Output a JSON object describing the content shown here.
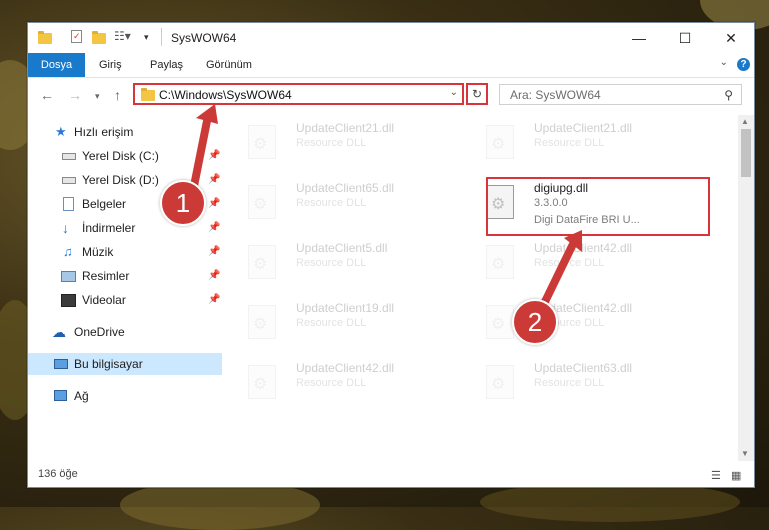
{
  "window": {
    "title": "SysWOW64"
  },
  "ribbon": {
    "tabs": [
      "Dosya",
      "Giriş",
      "Paylaş",
      "Görünüm"
    ]
  },
  "address": {
    "path": "C:\\Windows\\SysWOW64"
  },
  "search": {
    "placeholder": "Ara: SysWOW64"
  },
  "sidebar": {
    "quick_access": "Hızlı erişim",
    "items": [
      {
        "label": "Yerel Disk (C:)",
        "icon": "drive-icon"
      },
      {
        "label": "Yerel Disk (D:)",
        "icon": "drive-icon"
      },
      {
        "label": "Belgeler",
        "icon": "documents-icon"
      },
      {
        "label": "İndirmeler",
        "icon": "downloads-icon"
      },
      {
        "label": "Müzik",
        "icon": "music-icon"
      },
      {
        "label": "Resimler",
        "icon": "pictures-icon"
      },
      {
        "label": "Videolar",
        "icon": "videos-icon"
      }
    ],
    "onedrive": "OneDrive",
    "this_pc": "Bu bilgisayar",
    "network": "Ağ"
  },
  "files_left": [
    {
      "name": "UpdateClient21.dll",
      "desc": "Resource DLL"
    },
    {
      "name": "UpdateClient65.dll",
      "desc": "Resource DLL"
    },
    {
      "name": "UpdateClient5.dll",
      "desc": "Resource DLL"
    },
    {
      "name": "UpdateClient19.dll",
      "desc": "Resource DLL"
    },
    {
      "name": "UpdateClient42.dll",
      "desc": "Resource DLL"
    }
  ],
  "files_right": [
    {
      "name": "UpdateClient21.dll",
      "desc": "Resource DLL"
    },
    {
      "name": "digiupg.dll",
      "version": "3.3.0.0",
      "desc": "Digi DataFire BRI U..."
    },
    {
      "name": "UpdateClient42.dll",
      "desc": "Resource DLL"
    },
    {
      "name": "UpdateClient42.dll",
      "desc": "Resource DLL"
    },
    {
      "name": "UpdateClient63.dll",
      "desc": "Resource DLL"
    }
  ],
  "status": {
    "count": "136 öğe"
  },
  "callouts": {
    "one": "1",
    "two": "2"
  },
  "colors": {
    "accent": "#1979ca",
    "highlight": "#d9343c",
    "callout": "#cc3a37",
    "selected": "#cce8ff"
  }
}
